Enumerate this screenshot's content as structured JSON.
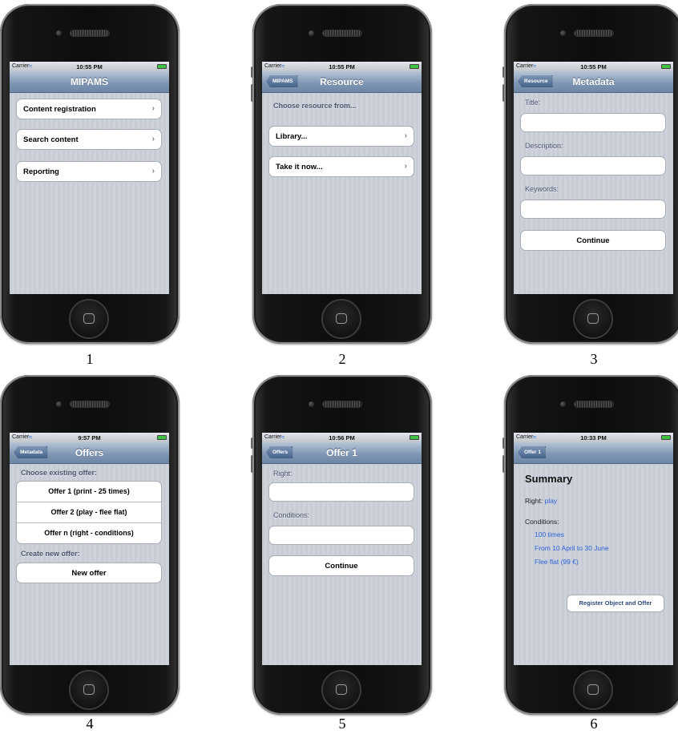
{
  "status": {
    "carrier": "Carrier",
    "battery": "battery-icon",
    "wifi": "wifi-icon"
  },
  "screens": [
    {
      "caption": "1",
      "time": "10:55 PM",
      "title": "MIPAMS",
      "back": "",
      "items": [
        "Content registration",
        "Search content",
        "Reporting"
      ]
    },
    {
      "caption": "2",
      "time": "10:55 PM",
      "title": "Resource",
      "back": "MIPAMS",
      "prompt": "Choose resource from...",
      "items": [
        "Library...",
        "Take it now..."
      ]
    },
    {
      "caption": "3",
      "time": "10:55 PM",
      "title": "Metadata",
      "back": "Resource",
      "fields": [
        "Title:",
        "Description:",
        "Keywords:"
      ],
      "button": "Continue"
    },
    {
      "caption": "4",
      "time": "9:57 PM",
      "title": "Offers",
      "back": "Metadata",
      "existing_label": "Choose existing offer:",
      "offers": [
        "Offer 1 (print - 25 times)",
        "Offer 2 (play - flee flat)",
        "Offer n (right - conditions)"
      ],
      "new_label": "Create new offer:",
      "new_button": "New offer"
    },
    {
      "caption": "5",
      "time": "10:56 PM",
      "title": "Offer 1",
      "back": "Offers",
      "fields": [
        "Right:",
        "Conditions:"
      ],
      "button": "Continue"
    },
    {
      "caption": "6",
      "time": "10:33 PM",
      "title": "",
      "back": "Offer 1",
      "summary_title": "Summary",
      "right_label": "Right:",
      "right_value": "play",
      "conditions_label": "Conditions:",
      "conditions": [
        "100 times",
        "From 10 April to 30 June",
        "Flee flat (99 €)"
      ],
      "button": "Register Object and Offer"
    }
  ]
}
